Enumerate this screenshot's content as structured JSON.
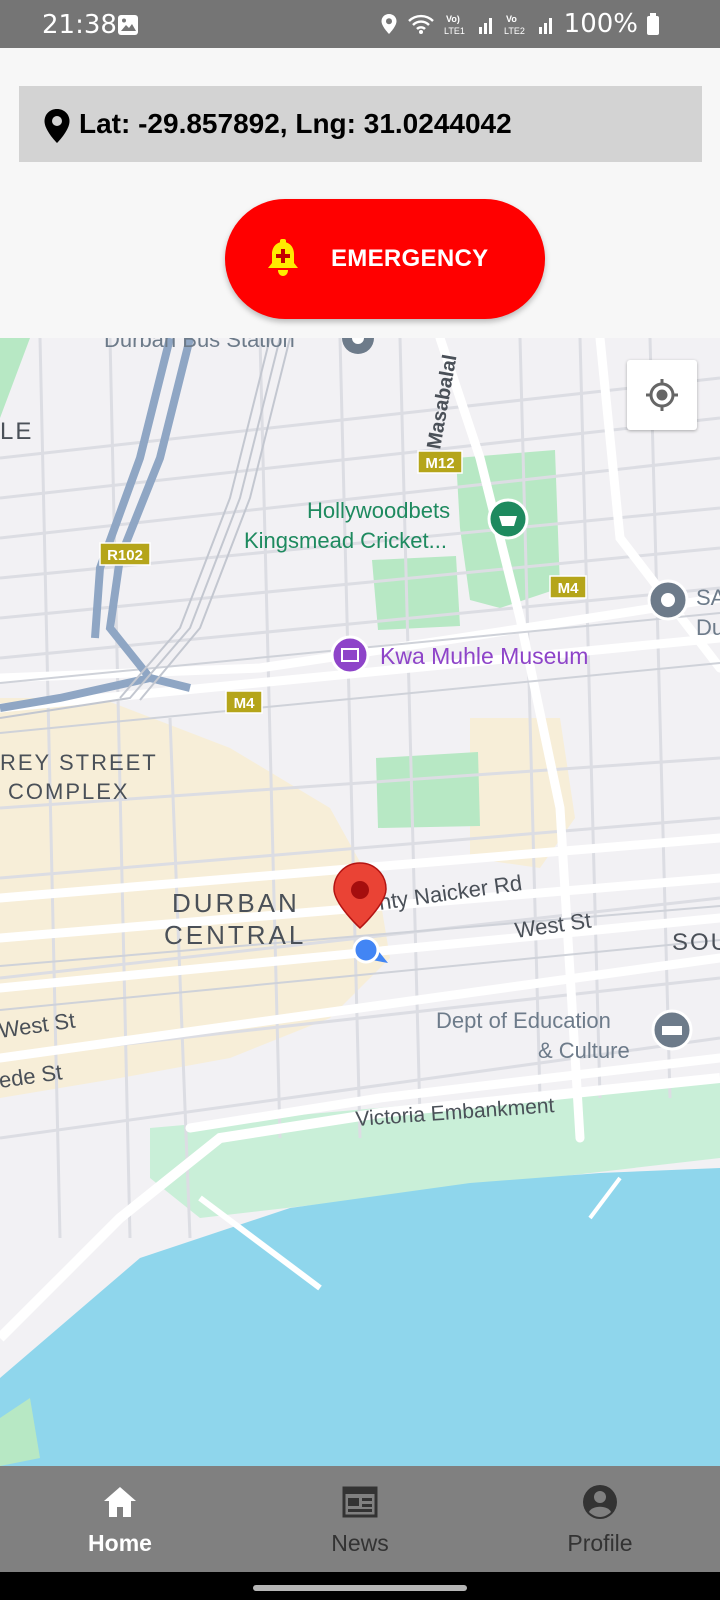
{
  "status_bar": {
    "time": "21:38",
    "battery": "100%",
    "icons": [
      "gallery-icon",
      "location-icon",
      "wifi-icon",
      "volte-lte1-icon",
      "signal-icon",
      "volte-lte2-icon",
      "signal-icon",
      "battery-icon"
    ]
  },
  "location": {
    "text": "Lat: -29.857892, Lng: 31.0244042",
    "icon": "map-pin-icon"
  },
  "emergency_button": {
    "label": "EMERGENCY",
    "icon": "bell-plus-icon",
    "color": "#ff0000",
    "icon_color": "#ffeb00"
  },
  "map": {
    "labels": {
      "bus_station": "Durban Bus Station",
      "masabalala": "Masabalal",
      "m12": "M12",
      "r102": "R102",
      "m4_a": "M4",
      "m4_b": "M4",
      "cricket_line1": "Hollywoodbets",
      "cricket_line2": "Kingsmead Cricket...",
      "museum": "Kwa Muhle Museum",
      "street_complex_line1": "REY STREET",
      "street_complex_line2": "COMPLEX",
      "durban_central_line1": "DURBAN",
      "durban_central_line2": "CENTRAL",
      "naicker_rd": "nty Naicker Rd",
      "west_st_east": "West St",
      "west_st_west": "West St",
      "ede_st": "ede St",
      "south_fragment": "SOU",
      "le_fragment": "LE",
      "sa_fragment_1": "SA",
      "sa_fragment_2": "Du",
      "education_line1": "Dept of Education",
      "education_line2": "& Culture",
      "victoria": "Victoria Embankment"
    },
    "colors": {
      "land": "#f2f1f4",
      "water": "#8fd6ec",
      "park": "#b7e8c4",
      "urban": "#f7eed8",
      "road": "#ffffff",
      "highway": "#8fa6c4",
      "marker": "#ea4335",
      "my_location": "#4285f4",
      "poi_green": "#1e8a5f",
      "poi_purple": "#8e44c9",
      "poi_gray": "#6d7b8a"
    },
    "my_location_button": "my-location-icon"
  },
  "bottom_nav": {
    "items": [
      {
        "label": "Home",
        "icon": "home-icon",
        "active": true
      },
      {
        "label": "News",
        "icon": "newspaper-icon",
        "active": false
      },
      {
        "label": "Profile",
        "icon": "profile-icon",
        "active": false
      }
    ]
  }
}
